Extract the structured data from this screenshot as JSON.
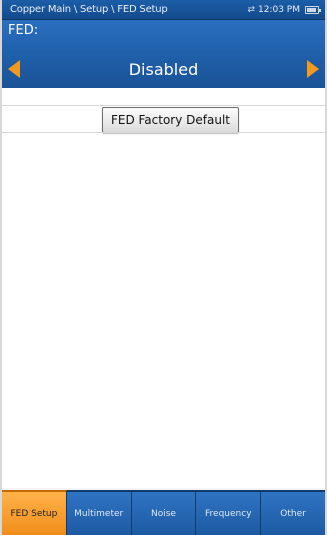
{
  "titlebar": {
    "path": "Copper Main \\ Setup \\ FED Setup",
    "time": "12:03 PM"
  },
  "selector": {
    "label": "FED:",
    "value": "Disabled"
  },
  "content": {
    "factory_default_label": "FED Factory Default"
  },
  "tabs": [
    {
      "label": "FED Setup",
      "active": true
    },
    {
      "label": "Multimeter",
      "active": false
    },
    {
      "label": "Noise",
      "active": false
    },
    {
      "label": "Frequency",
      "active": false
    },
    {
      "label": "Other",
      "active": false
    }
  ],
  "colors": {
    "title_bar": "#134b8c",
    "selector_bg": "#1f5ea8",
    "arrow": "#f39a1e",
    "tab_active": "#f08d1a",
    "tab_inactive": "#1d5aa3"
  }
}
